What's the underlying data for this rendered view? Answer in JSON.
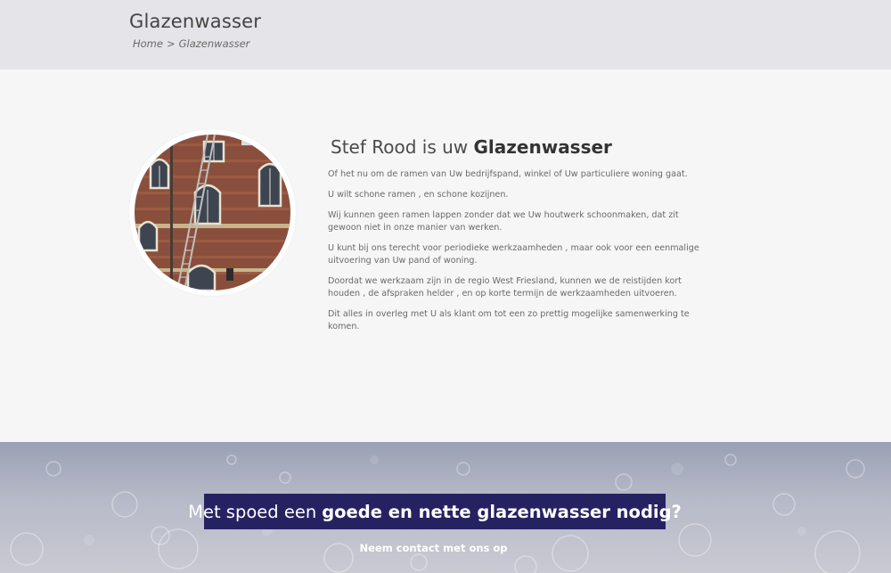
{
  "header": {
    "title": "Glazenwasser",
    "breadcrumb": {
      "home": "Home",
      "separator": ">",
      "current": "Glazenwasser"
    }
  },
  "main": {
    "heading_prefix": "Stef Rood is uw",
    "heading_strong": "Glazenwasser",
    "paragraphs": [
      "Of het nu om de ramen van Uw  bedrijfspand, winkel of Uw particuliere woning gaat.",
      "U wilt schone ramen , en schone kozijnen.",
      "Wij kunnen geen ramen lappen zonder dat we Uw houtwerk schoonmaken, dat zit gewoon niet in onze manier van werken.",
      "U kunt bij ons terecht voor periodieke werkzaamheden , maar ook voor een eenmalige uitvoering van Uw pand of woning.",
      "Doordat we werkzaam zijn in de regio West Friesland, kunnen we de reistijden kort houden , de afspraken helder , en op korte termijn de werkzaamheden uitvoeren.",
      "Dit alles in overleg met U als klant om tot een zo prettig mogelijke samenwerking te komen."
    ]
  },
  "cta": {
    "prefix": "Met spoed een",
    "strong": "goede en nette glazenwasser nodig?",
    "link": "Neem contact met ons op"
  },
  "colors": {
    "header_bg": "#e4e4e9",
    "content_bg": "#f6f6f6",
    "cta_box_bg": "#262262",
    "cta_text": "#ffffff"
  }
}
